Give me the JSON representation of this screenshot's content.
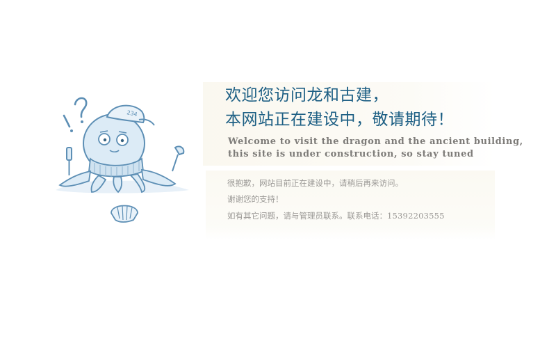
{
  "welcome": {
    "title_line1": "欢迎您访问龙和古建，",
    "title_line2": "本网站正在建设中，敬请期待！",
    "english_line1": "Welcome to visit the dragon and the ancient building,",
    "english_line2": "this site is under construction, so stay tuned"
  },
  "notice": {
    "line1": "很抱歉，网站目前正在建设中，请稍后再来访问。",
    "line2": "谢谢您的支持！",
    "line3_prefix": "如有其它问题，请与管理员联系。联系电话：",
    "phone": "15392203555"
  },
  "mascot": {
    "hat_number": "234",
    "icons": [
      "exclamation-icon",
      "question-mark-icon",
      "screwdriver-icon",
      "wrench-icon",
      "shell-icon"
    ]
  },
  "colors": {
    "title": "#1d5f84",
    "english": "#7d7b78",
    "notice": "#9a9895",
    "mascot_stroke": "#5d8fb5",
    "mascot_fill": "#dcebf6"
  }
}
